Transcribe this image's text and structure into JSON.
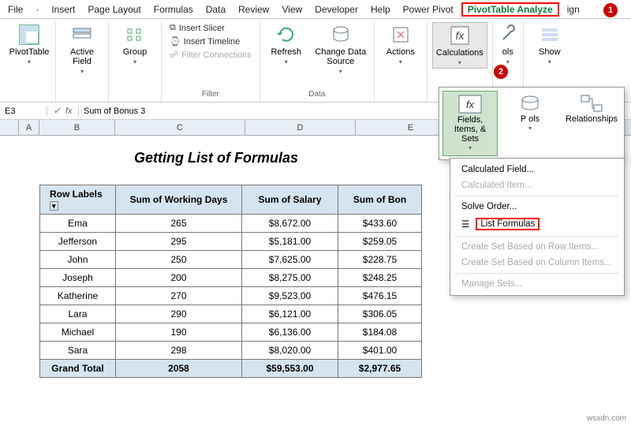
{
  "tabs": [
    "File",
    "·",
    "Insert",
    "Page Layout",
    "Formulas",
    "Data",
    "Review",
    "View",
    "Developer",
    "Help",
    "Power Pivot",
    "PivotTable Analyze",
    "ign"
  ],
  "active_tab": "PivotTable Analyze",
  "ribbon": {
    "pivottable": "PivotTable",
    "active_field": "Active Field",
    "group": "Group",
    "insert_slicer": "Insert Slicer",
    "insert_timeline": "Insert Timeline",
    "filter_connections": "Filter Connections",
    "filter_group": "Filter",
    "refresh": "Refresh",
    "change_data_source": "Change Data Source",
    "data_group": "Data",
    "actions": "Actions",
    "calculations": "Calculations",
    "tools": "ols",
    "show": "Show"
  },
  "popup1": {
    "fields_items_sets": "Fields, Items, & Sets",
    "olap_tools": "P ols",
    "relationships": "Relationships"
  },
  "popup2": {
    "calculated_field": "Calculated Field...",
    "calculated_item": "Calculated Item...",
    "solve_order": "Solve Order...",
    "list_formulas": "List Formulas",
    "create_row": "Create Set Based on Row Items...",
    "create_col": "Create Set Based on Column Items...",
    "manage_sets": "Manage Sets..."
  },
  "namebox": "E3",
  "fx": "fx",
  "formula_content": "Sum of Bonus 3",
  "cols": [
    "A",
    "B",
    "C",
    "D",
    "E"
  ],
  "title": "Getting List of Formulas",
  "headers": [
    "Row Labels",
    "Sum of Working Days",
    "Sum of Salary",
    "Sum of Bon"
  ],
  "rows": [
    {
      "n": "Ema",
      "d": "265",
      "s": "$8,672.00",
      "b": "$433.60"
    },
    {
      "n": "Jefferson",
      "d": "295",
      "s": "$5,181.00",
      "b": "$259.05"
    },
    {
      "n": "John",
      "d": "250",
      "s": "$7,625.00",
      "b": "$228.75"
    },
    {
      "n": "Joseph",
      "d": "200",
      "s": "$8,275.00",
      "b": "$248.25"
    },
    {
      "n": "Katherine",
      "d": "270",
      "s": "$9,523.00",
      "b": "$476.15"
    },
    {
      "n": "Lara",
      "d": "290",
      "s": "$6,121.00",
      "b": "$306.05"
    },
    {
      "n": "Michael",
      "d": "190",
      "s": "$6,136.00",
      "b": "$184.08"
    },
    {
      "n": "Sara",
      "d": "298",
      "s": "$8,020.00",
      "b": "$401.00"
    }
  ],
  "total": {
    "n": "Grand Total",
    "d": "2058",
    "s": "$59,553.00",
    "b": "$2,977.65"
  },
  "watermark": "wsxdn.com"
}
